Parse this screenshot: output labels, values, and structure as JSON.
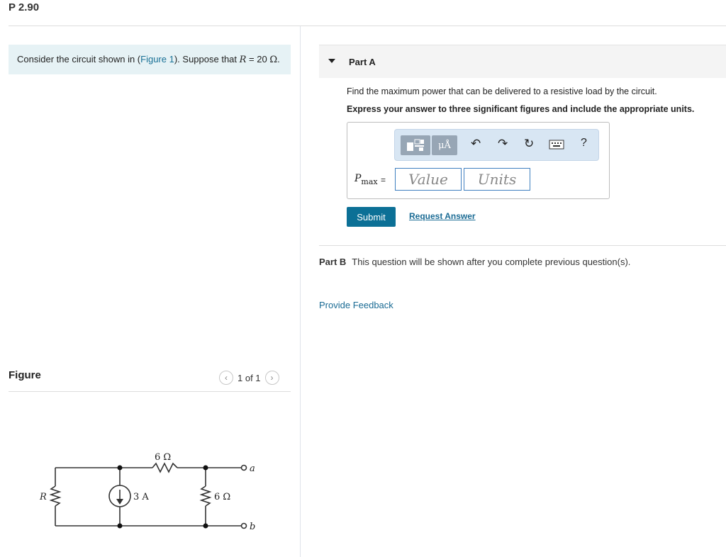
{
  "problem": {
    "title": "P 2.90"
  },
  "intro": {
    "prefix": "Consider the circuit shown in (",
    "figure_link": "Figure 1",
    "middle": "). Suppose that ",
    "variable": "R",
    "equals": " = 20 ",
    "unit": "Ω",
    "suffix": "."
  },
  "figure": {
    "label": "Figure",
    "pager": "1 of 1",
    "prev_icon": "chevron-left-icon",
    "next_icon": "chevron-right-icon",
    "circuit": {
      "r_label": "R",
      "source_label": "3 A",
      "top_resistor_label": "6 Ω",
      "shunt_resistor_label": "6 Ω",
      "terminal_a": "a",
      "terminal_b": "b"
    }
  },
  "partA": {
    "title": "Part A",
    "question": "Find the maximum power that can be delivered to a resistive load by the circuit.",
    "instruction": "Express your answer to three significant figures and include the appropriate units.",
    "toolbar": {
      "templates_icon": "templates-icon",
      "units_label": "μÅ",
      "undo_icon": "undo-icon",
      "redo_icon": "redo-icon",
      "reset_icon": "reset-icon",
      "keyboard_icon": "keyboard-icon",
      "help_label": "?"
    },
    "answer_var": "P",
    "answer_sub": "max",
    "equals": "=",
    "value_placeholder": "Value",
    "units_placeholder": "Units",
    "submit_label": "Submit",
    "request_label": "Request Answer"
  },
  "partB": {
    "title": "Part B",
    "message": "This question will be shown after you complete previous question(s)."
  },
  "feedback_label": "Provide Feedback",
  "colors": {
    "accent": "#0c7096",
    "link": "#1a6b94",
    "intro_bg": "#e6f2f5",
    "toolbar_bg": "#d8e6f3"
  }
}
